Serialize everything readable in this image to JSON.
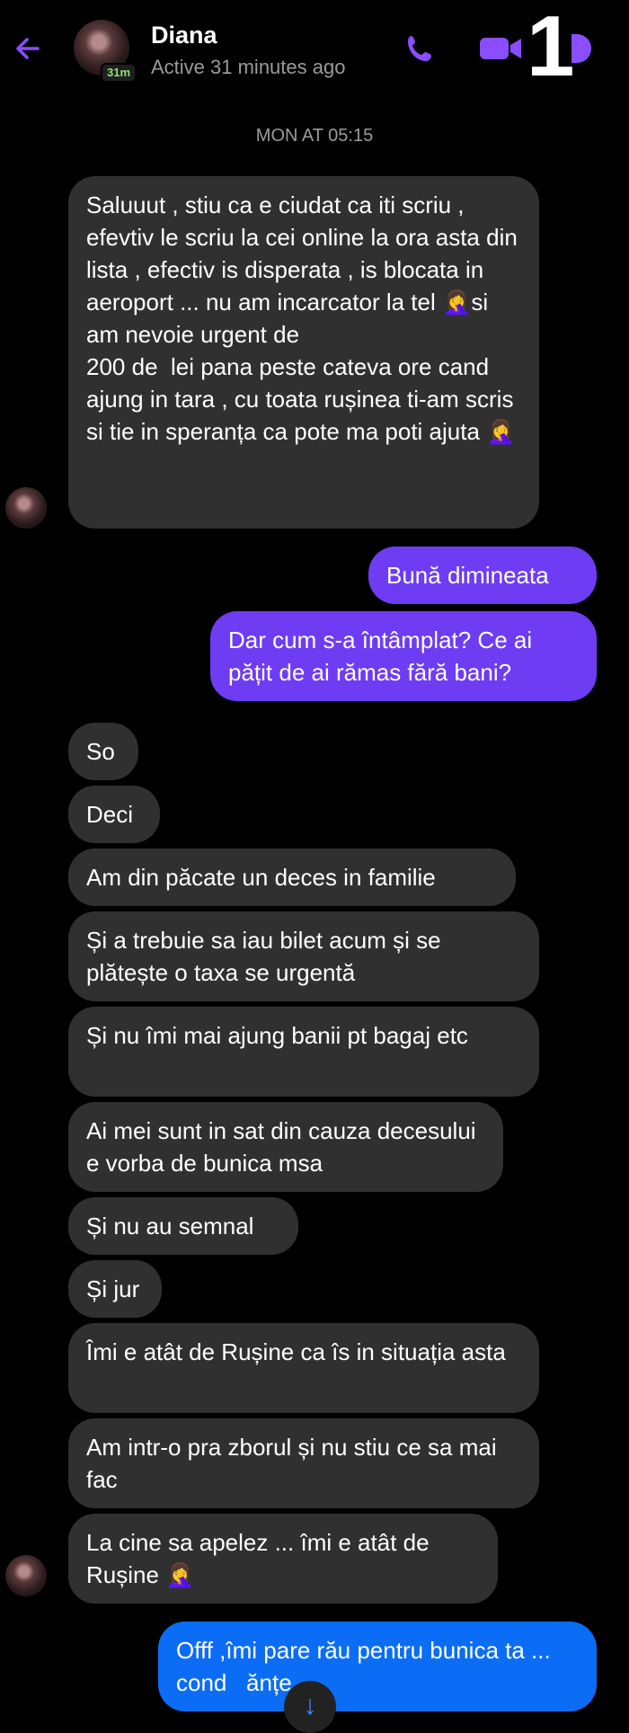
{
  "header": {
    "name": "Diana",
    "status": "Active 31 minutes ago",
    "avatar_badge": "31m",
    "overlay_number": "1",
    "icons": {
      "back": "back-arrow-icon",
      "call": "phone-icon",
      "video": "video-camera-icon",
      "info": "info-icon"
    },
    "accent_color": "#8a4dff"
  },
  "timestamp": "MON AT 05:15",
  "messages": [
    {
      "from": "them",
      "text": "Saluuut , stiu ca e ciudat ca iti scriu , efevtiv le scriu la cei online la ora asta din lista , efectiv is disperata , is blocata in aeroport ... nu am incarcator la tel 🤦‍♀️si am nevoie urgent de\n200 de  lei pana peste cateva ore cand ajung in tara , cu toata rușinea ti-am scris si tie in speranța ca pote ma poti ajuta 🤦‍♀️"
    },
    {
      "from": "me",
      "text": "Bună dimineata"
    },
    {
      "from": "me",
      "text": "Dar cum s-a întâmplat? Ce ai pățit de ai rămas fără bani?"
    },
    {
      "from": "them",
      "text": "So"
    },
    {
      "from": "them",
      "text": "Deci"
    },
    {
      "from": "them",
      "text": "Am din păcate un deces in familie"
    },
    {
      "from": "them",
      "text": "Și a trebuie sa iau bilet acum și se plătește o taxa se urgentă"
    },
    {
      "from": "them",
      "text": "Și nu îmi mai ajung banii pt bagaj etc"
    },
    {
      "from": "them",
      "text": "Ai mei sunt in sat din cauza decesului e vorba de bunica msa"
    },
    {
      "from": "them",
      "text": "Și nu au semnal"
    },
    {
      "from": "them",
      "text": "Și jur"
    },
    {
      "from": "them",
      "text": "Îmi e atât de Rușine ca îs in situația asta"
    },
    {
      "from": "them",
      "text": "Am intr-o pra zborul și nu stiu ce sa mai fac"
    },
    {
      "from": "them",
      "text": "La cine sa apelez ... îmi e atât de Rușine 🤦‍♀️"
    },
    {
      "from": "me",
      "text": "Offf ,îmi pare rău pentru bunica ta ... cond   ănțe"
    }
  ],
  "scroll_button_icon": "arrow-down-icon"
}
